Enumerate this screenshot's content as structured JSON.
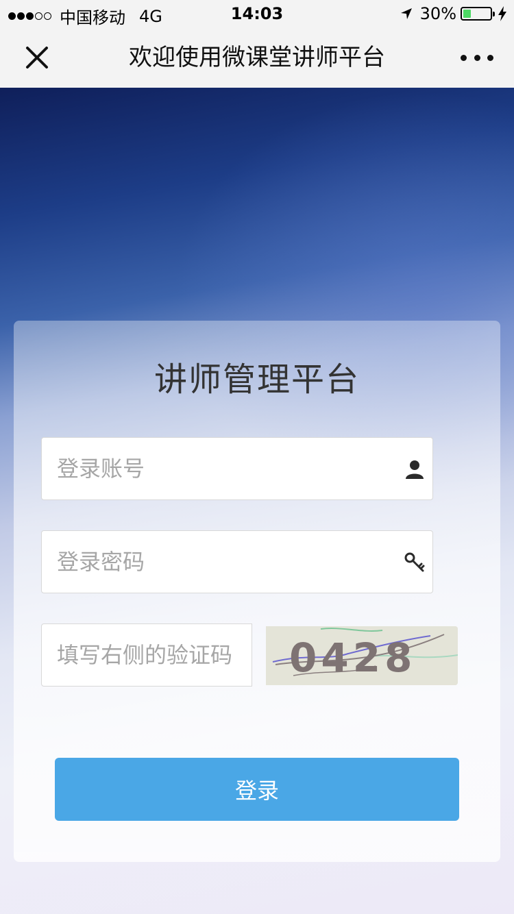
{
  "status_bar": {
    "carrier": "中国移动",
    "network": "4G",
    "time": "14:03",
    "battery": "30%",
    "battery_level": 0.3,
    "signal_strength": 3
  },
  "nav": {
    "title": "欢迎使用微课堂讲师平台",
    "close_icon": "close-icon",
    "more_icon": "more-icon"
  },
  "card": {
    "title": "讲师管理平台"
  },
  "form": {
    "account_placeholder": "登录账号",
    "account_value": "",
    "account_icon": "user-icon",
    "password_placeholder": "登录密码",
    "password_value": "",
    "password_icon": "key-icon",
    "captcha_placeholder": "填写右侧的验证码",
    "captcha_value": "",
    "captcha_code": "0428",
    "login_label": "登录"
  },
  "colors": {
    "login_button": "#4aa7e6",
    "bar_bg": "#f3f3f3",
    "battery_fill": "#4cd964"
  }
}
